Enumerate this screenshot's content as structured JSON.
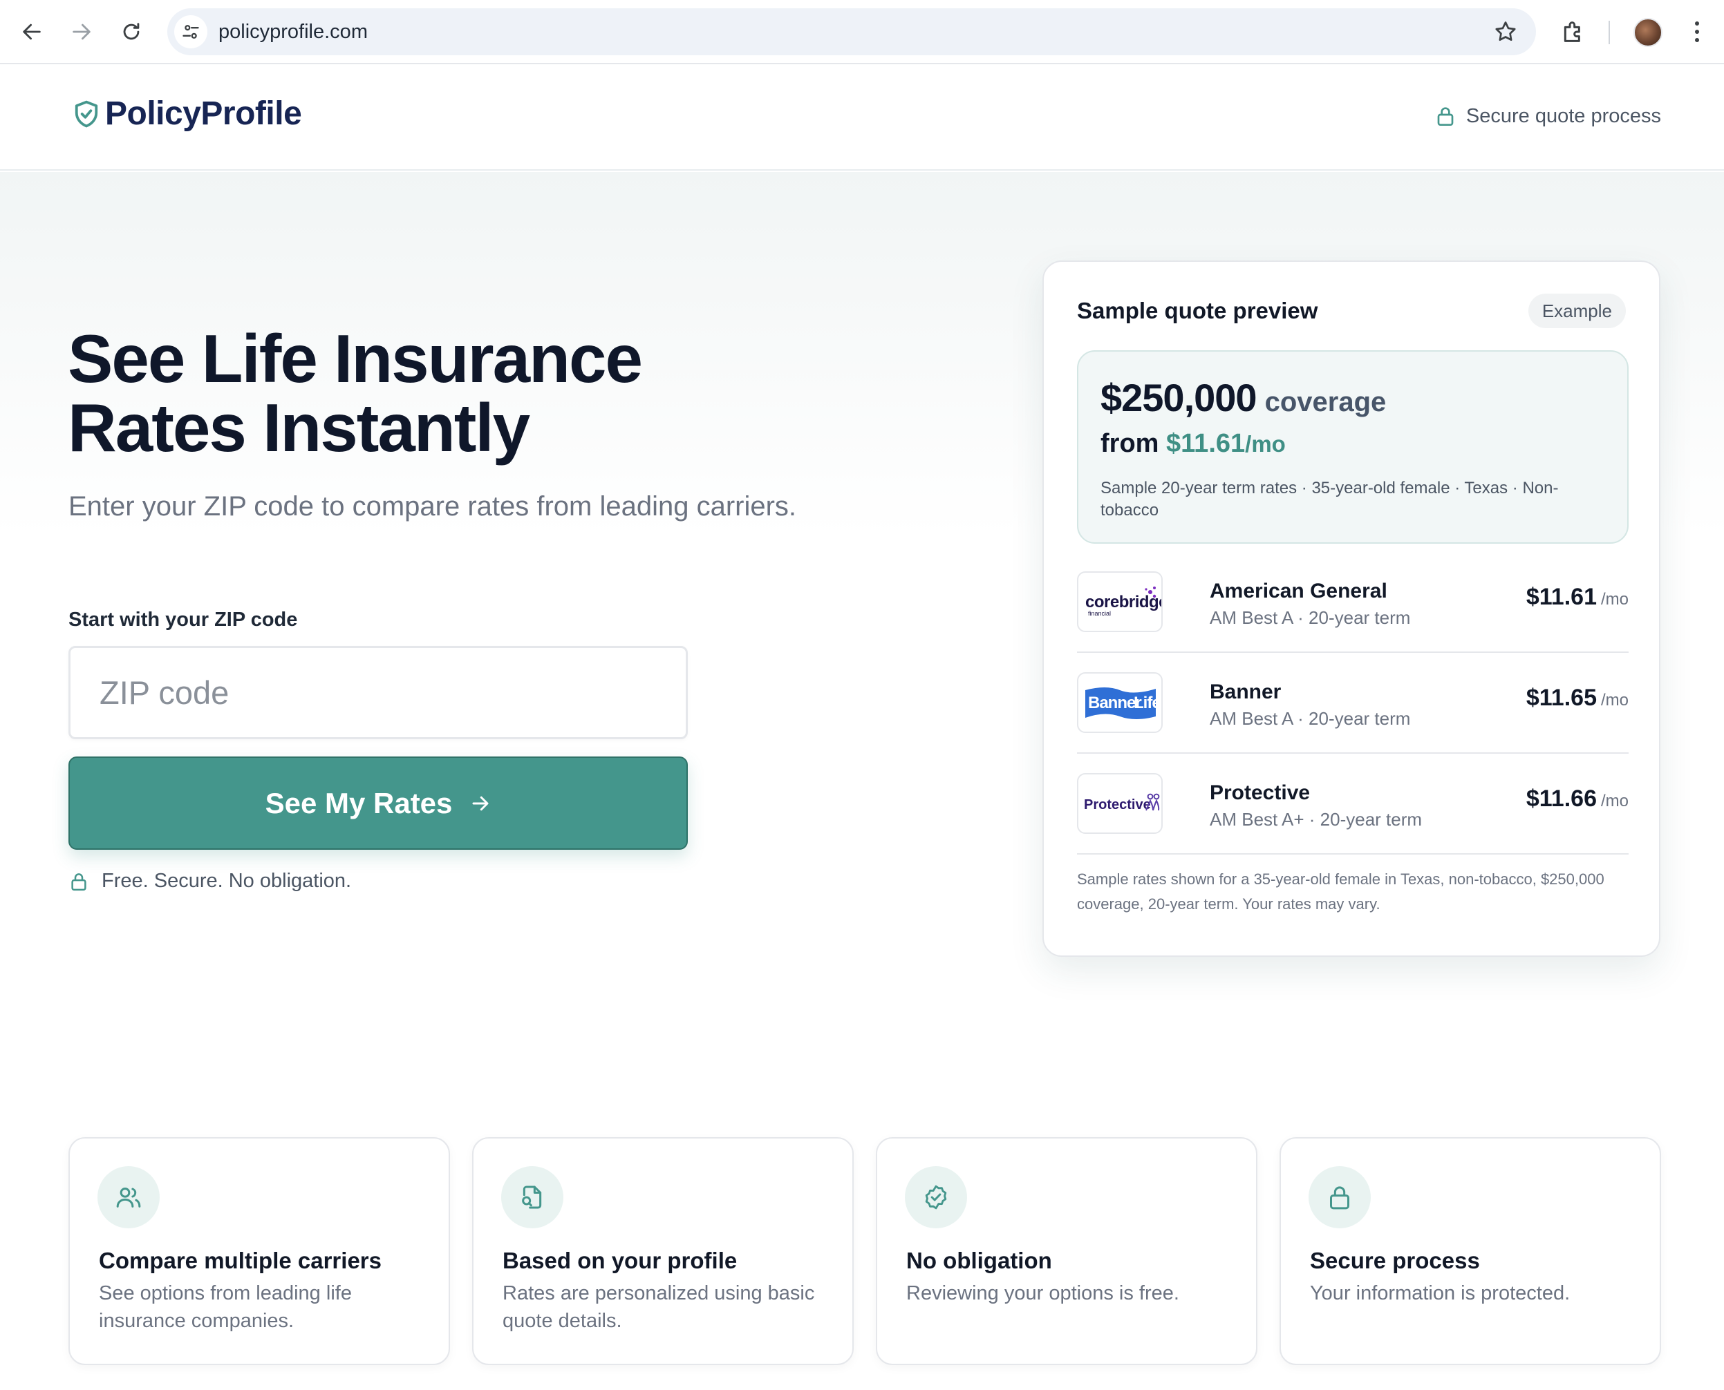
{
  "browser": {
    "url": "policyprofile.com"
  },
  "header": {
    "brand": "PolicyProfile",
    "secure_label": "Secure quote process"
  },
  "hero": {
    "headline_line1": "See Life Insurance",
    "headline_line2": "Rates Instantly",
    "subheadline": "Enter your ZIP code to compare rates from leading carriers.",
    "zip_label": "Start with your ZIP code",
    "zip_placeholder": "ZIP code",
    "zip_value": "",
    "cta_label": "See My Rates",
    "assurance": "Free. Secure. No obligation."
  },
  "quote_preview": {
    "title": "Sample quote preview",
    "badge": "Example",
    "coverage_amount": "$250,000",
    "coverage_word": "coverage",
    "from_word": "from",
    "from_price": "$11.61",
    "from_unit": "/mo",
    "summary_note": "Sample 20-year term rates · 35-year-old female · Texas · Non-tobacco",
    "carriers": [
      {
        "name": "American General",
        "meta": "AM Best A · 20-year term",
        "price": "$11.61",
        "unit": "/mo",
        "logo": "corebridge financial",
        "logo_icon": "corebridge-logo"
      },
      {
        "name": "Banner",
        "meta": "AM Best A · 20-year term",
        "price": "$11.65",
        "unit": "/mo",
        "logo": "BannerLife",
        "logo_icon": "banner-life-logo"
      },
      {
        "name": "Protective",
        "meta": "AM Best A+ · 20-year term",
        "price": "$11.66",
        "unit": "/mo",
        "logo": "Protective",
        "logo_icon": "protective-logo"
      }
    ],
    "footnote": "Sample rates shown for a 35-year-old female in Texas, non-tobacco, $250,000 coverage, 20-year term. Your rates may vary."
  },
  "features": [
    {
      "icon": "users-icon",
      "title": "Compare multiple carriers",
      "text": "See options from leading life insurance companies."
    },
    {
      "icon": "document-search-icon",
      "title": "Based on your profile",
      "text": "Rates are personalized using basic quote details."
    },
    {
      "icon": "badge-check-icon",
      "title": "No obligation",
      "text": "Reviewing your options is free."
    },
    {
      "icon": "lock-icon",
      "title": "Secure process",
      "text": "Your information is protected."
    }
  ],
  "colors": {
    "accent": "#44968c",
    "brand_navy": "#172554",
    "headline": "#0f172a",
    "muted": "#6b7280"
  }
}
